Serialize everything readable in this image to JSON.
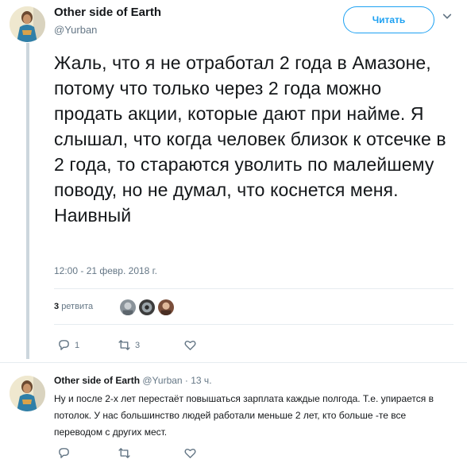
{
  "tweet": {
    "author_name": "Other side of Earth",
    "author_handle": "@Yurban",
    "follow_label": "Читать",
    "text": "Жаль, что я не отработал 2 года в Амазоне, потому что только через 2 года можно продать акции, которые дают при найме. Я слышал, что когда человек близок к отсечке в 2 года, то стараются уволить по малейшему поводу, но не думал, что коснется меня. Наивный",
    "timestamp": "12:00 - 21 февр. 2018 г.",
    "retweet_count": "3",
    "retweet_word": "ретвита",
    "reply_count": "1",
    "retweet_action_count": "3",
    "like_count": ""
  },
  "reply": {
    "author_name": "Other side of Earth",
    "meta": "@Yurban · 13 ч.",
    "text": "Ну и после 2-х лет перестаёт повышаться зарплата каждые полгода. Т.е. упирается в потолок. У нас большинство людей работали меньше 2 лет, кто больше -те все переводом с других мест."
  },
  "colors": {
    "accent": "#1da1f2",
    "muted": "#657786",
    "text": "#14171a",
    "thread_line": "#ccd6dd"
  },
  "icons": [
    "chevron-down-icon",
    "reply-icon",
    "retweet-icon",
    "heart-icon"
  ]
}
